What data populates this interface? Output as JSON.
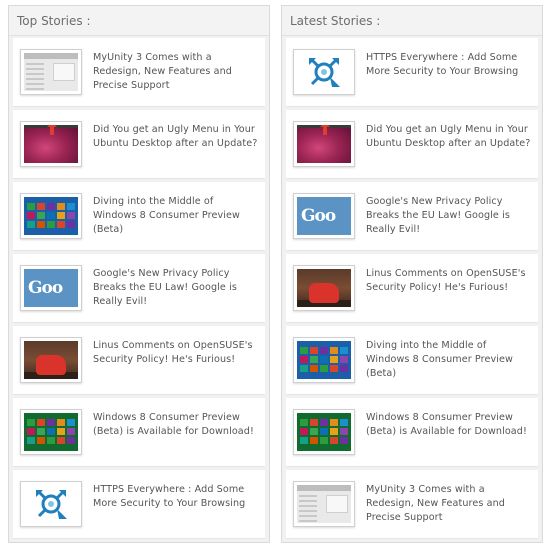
{
  "top_stories": {
    "header": "Top Stories :",
    "items": [
      {
        "title": "MyUnity 3 Comes with a Redesign, New Features and Precise Support",
        "thumb": "myunity"
      },
      {
        "title": "Did You get an Ugly Menu in Your Ubuntu Desktop after an Update?",
        "thumb": "menu"
      },
      {
        "title": "Diving into the Middle of Windows 8 Consumer Preview (Beta)",
        "thumb": "win8"
      },
      {
        "title": "Google's New Privacy Policy Breaks the EU Law! Google is Really Evil!",
        "thumb": "google"
      },
      {
        "title": "Linus Comments on OpenSUSE's Security Policy! He's Furious!",
        "thumb": "linus"
      },
      {
        "title": "Windows 8 Consumer Preview (Beta) is Available for Download!",
        "thumb": "win8green"
      },
      {
        "title": "HTTPS Everywhere : Add Some More Security to Your Browsing",
        "thumb": "https"
      }
    ]
  },
  "latest_stories": {
    "header": "Latest Stories :",
    "items": [
      {
        "title": "HTTPS Everywhere : Add Some More Security to Your Browsing",
        "thumb": "https"
      },
      {
        "title": "Did You get an Ugly Menu in Your Ubuntu Desktop after an Update?",
        "thumb": "menu"
      },
      {
        "title": "Google's New Privacy Policy Breaks the EU Law! Google is Really Evil!",
        "thumb": "google"
      },
      {
        "title": "Linus Comments on OpenSUSE's Security Policy! He's Furious!",
        "thumb": "linus"
      },
      {
        "title": "Diving into the Middle of Windows 8 Consumer Preview (Beta)",
        "thumb": "win8"
      },
      {
        "title": "Windows 8 Consumer Preview (Beta) is Available for Download!",
        "thumb": "win8green"
      },
      {
        "title": "MyUnity 3 Comes with a Redesign, New Features and Precise Support",
        "thumb": "myunity"
      }
    ]
  },
  "thumb_google_text": "Goo",
  "colors": {
    "text": "#555555",
    "header_text": "#6d6d6d",
    "panel_bg": "#f1f1f1",
    "border": "#dadada"
  }
}
